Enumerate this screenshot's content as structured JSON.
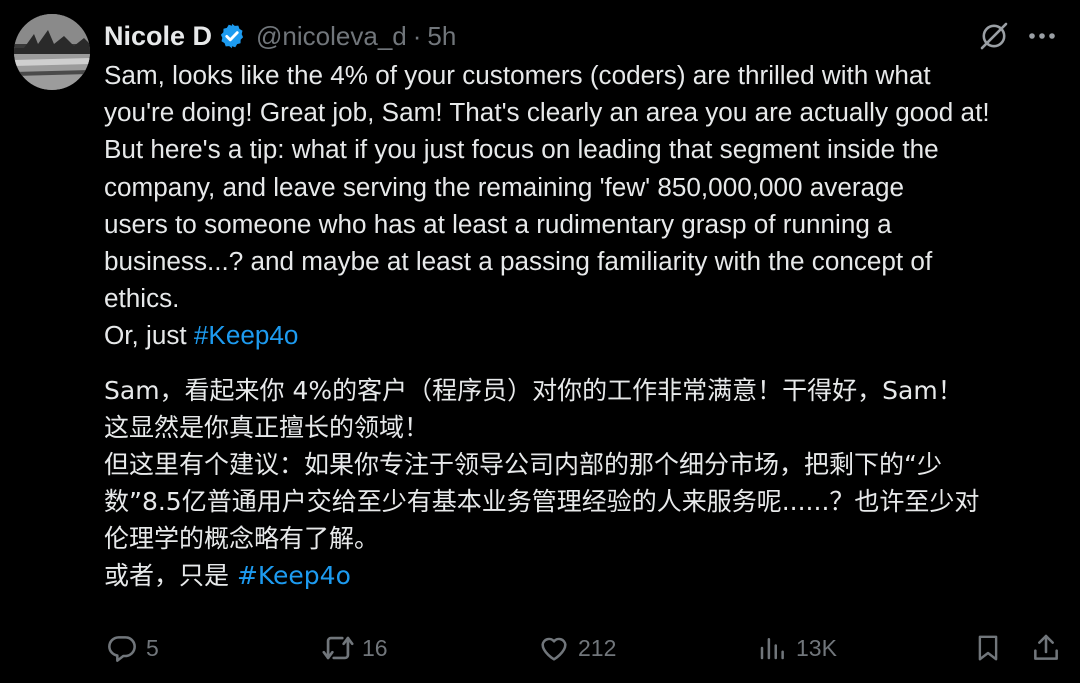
{
  "tweet": {
    "author": {
      "display_name": "Nicole D",
      "handle": "@nicoleva_d",
      "separator": "·",
      "time": "5h",
      "verified_icon": "verified-badge-icon"
    },
    "top_actions": {
      "grok_icon": "grok-icon",
      "more_icon": "more-icon"
    },
    "text_en": {
      "lines_block": "Sam, looks like the 4% of your customers (coders) are thrilled with what\nyou're doing! Great job, Sam! That's clearly an area you are actually good at!\nBut here's a tip: what if you just focus on leading that segment inside the\ncompany, and leave serving the remaining 'few' 850,000,000 average\nusers to someone who has at least a rudimentary grasp of running a\nbusiness...? and maybe at least a passing familiarity with the concept of\nethics.",
      "closing_prefix": "Or, just ",
      "hashtag": "#Keep4o"
    },
    "text_zh": {
      "lines_block": "Sam，看起来你 4%的客户（程序员）对你的工作非常满意！干得好，Sam！\n这显然是你真正擅长的领域！\n但这里有个建议：如果你专注于领导公司内部的那个细分市场，把剩下的“少\n数”8.5亿普通用户交给至少有基本业务管理经验的人来服务呢......？也许至少对\n伦理学的概念略有了解。",
      "closing_prefix": "或者，只是 ",
      "hashtag": "#Keep4o"
    },
    "metrics": {
      "replies": "5",
      "reposts": "16",
      "likes": "212",
      "views": "13K"
    },
    "colors": {
      "background": "#000000",
      "text": "#e7e9ea",
      "secondary": "#71767b",
      "link": "#1d9bf0",
      "verified": "#1d9bf0"
    }
  }
}
